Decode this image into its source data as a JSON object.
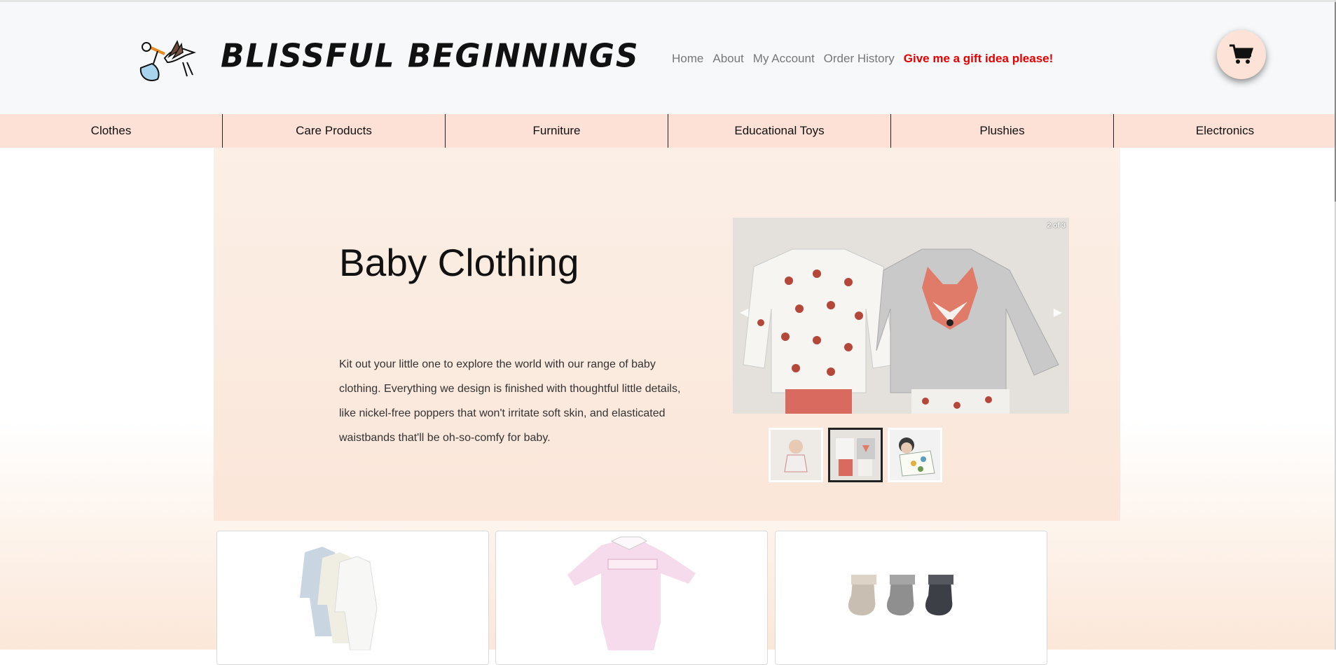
{
  "brand": {
    "name": "BLISSFUL BEGINNINGS",
    "logo_icon": "stork-icon"
  },
  "nav": {
    "home": "Home",
    "about": "About",
    "account": "My Account",
    "orders": "Order History",
    "gift": "Give me a gift idea please!"
  },
  "cart": {
    "icon": "cart-icon"
  },
  "categories": [
    "Clothes",
    "Care Products",
    "Furniture",
    "Educational Toys",
    "Plushies",
    "Electronics"
  ],
  "hero": {
    "title": "Baby Clothing",
    "text": "Kit out your little one to explore the world with our range of baby clothing. Everything we design is finished with thoughtful little details, like nickel-free poppers that won't irritate soft skin, and elasticated waistbands that'll be oh-so-comfy for baby.",
    "slide_counter": "2 of 3",
    "active_thumb": 2
  },
  "colors": {
    "accent_gift": "#e60000",
    "category_bar": "#fde1d7",
    "cart_bg": "#fde2d8"
  }
}
